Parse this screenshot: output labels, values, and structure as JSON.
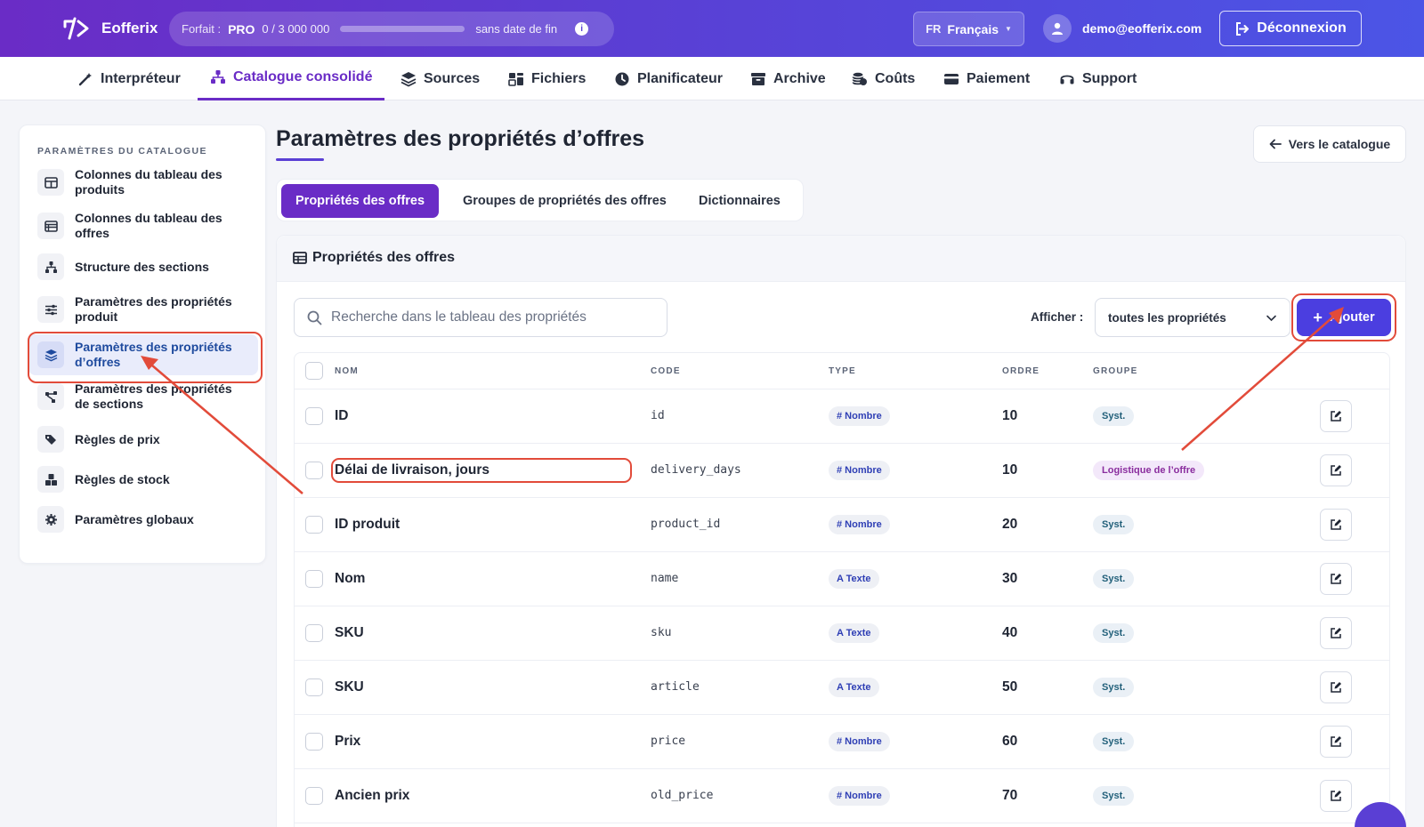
{
  "header": {
    "brand": "Eofferix",
    "plan_label": "Forfait :",
    "plan_name": "PRO",
    "plan_usage": "0  /  3 000 000",
    "plan_progress": 0,
    "plan_period": "sans date de fin",
    "info_icon": "info-icon",
    "lang_code": "FR",
    "lang_name": "Français",
    "user_email": "demo@eofferix.com",
    "logout_label": "Déconnexion"
  },
  "nav": {
    "items": [
      {
        "label": "Interpréteur",
        "icon": "magic-wand-icon"
      },
      {
        "label": "Catalogue consolidé",
        "icon": "sitemap-icon"
      },
      {
        "label": "Sources",
        "icon": "layers-icon"
      },
      {
        "label": "Fichiers",
        "icon": "files-icon"
      },
      {
        "label": "Planificateur",
        "icon": "clock-icon"
      },
      {
        "label": "Archive",
        "icon": "archive-icon"
      },
      {
        "label": "Coûts",
        "icon": "coins-icon"
      },
      {
        "label": "Paiement",
        "icon": "credit-card-icon"
      },
      {
        "label": "Support",
        "icon": "headset-icon"
      }
    ],
    "active_index": 1
  },
  "sidebar": {
    "title": "PARAMÈTRES DU CATALOGUE",
    "items": [
      {
        "label": "Colonnes du tableau des produits",
        "icon": "columns-icon"
      },
      {
        "label": "Colonnes du tableau des offres",
        "icon": "list-icon"
      },
      {
        "label": "Structure des sections",
        "icon": "tree-icon"
      },
      {
        "label": "Paramètres des propriétés produit",
        "icon": "sliders-icon"
      },
      {
        "label": "Paramètres des propriétés d’offres",
        "icon": "layers-icon"
      },
      {
        "label": "Paramètres des propriétés de sections",
        "icon": "share-nodes-icon"
      },
      {
        "label": "Règles de prix",
        "icon": "tags-icon"
      },
      {
        "label": "Règles de stock",
        "icon": "boxes-icon"
      },
      {
        "label": "Paramètres globaux",
        "icon": "gear-icon"
      }
    ],
    "active_index": 4
  },
  "main": {
    "title": "Paramètres des propriétés d’offres",
    "back_label": "Vers le catalogue",
    "tabs": [
      {
        "label": "Propriétés des offres"
      },
      {
        "label": "Groupes de propriétés des offres"
      },
      {
        "label": "Dictionnaires"
      }
    ],
    "active_tab": 0,
    "card_title": "Propriétés des offres",
    "search_placeholder": "Recherche dans le tableau des propriétés",
    "filter_label": "Afficher :",
    "filter_value": "toutes les propriétés",
    "add_label": "Ajouter"
  },
  "table": {
    "headers": {
      "name": "NOM",
      "code": "CODE",
      "type": "TYPE",
      "order": "ORDRE",
      "group": "GROUPE"
    },
    "rows": [
      {
        "name": "ID",
        "code": "id",
        "type": "# Nombre",
        "order": "10",
        "group": "Syst."
      },
      {
        "name": "Délai de livraison, jours",
        "code": "delivery_days",
        "type": "# Nombre",
        "order": "10",
        "group": "Logistique de l’offre"
      },
      {
        "name": "ID produit",
        "code": "product_id",
        "type": "# Nombre",
        "order": "20",
        "group": "Syst."
      },
      {
        "name": "Nom",
        "code": "name",
        "type": "A Texte",
        "order": "30",
        "group": "Syst."
      },
      {
        "name": "SKU",
        "code": "sku",
        "type": "A Texte",
        "order": "40",
        "group": "Syst."
      },
      {
        "name": "SKU",
        "code": "article",
        "type": "A Texte",
        "order": "50",
        "group": "Syst."
      },
      {
        "name": "Prix",
        "code": "price",
        "type": "# Nombre",
        "order": "60",
        "group": "Syst."
      },
      {
        "name": "Ancien prix",
        "code": "old_price",
        "type": "# Nombre",
        "order": "70",
        "group": "Syst."
      }
    ]
  },
  "colors": {
    "accent": "#6a2cc6",
    "primary_button": "#4b3ee0",
    "annotation": "#e24b3a"
  }
}
